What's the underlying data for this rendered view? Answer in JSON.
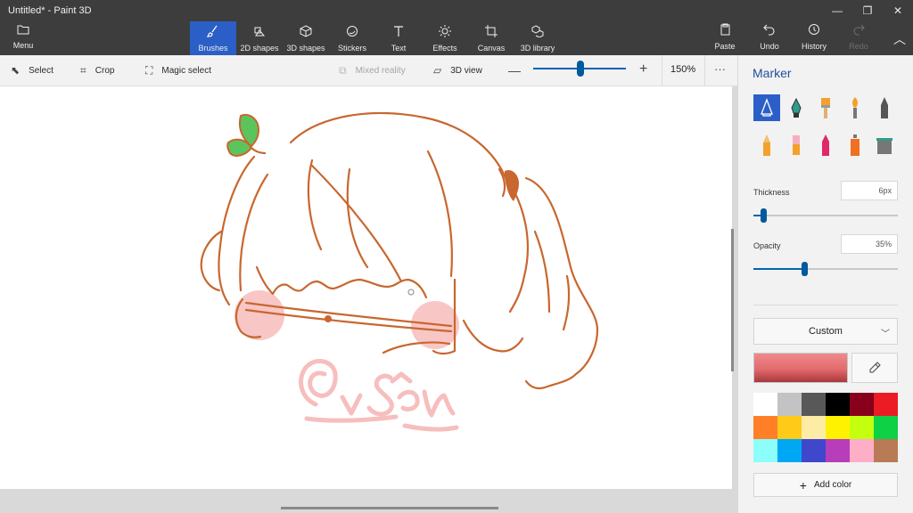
{
  "window": {
    "title": "Untitled* - Paint 3D",
    "minimize": "—",
    "maximize": "❐",
    "close": "✕"
  },
  "ribbon": {
    "menu_label": "Menu",
    "tabs": [
      {
        "label": "Brushes",
        "icon": "brush-icon",
        "active": true
      },
      {
        "label": "2D shapes",
        "icon": "2d-shapes-icon"
      },
      {
        "label": "3D shapes",
        "icon": "3d-shapes-icon"
      },
      {
        "label": "Stickers",
        "icon": "stickers-icon"
      },
      {
        "label": "Text",
        "icon": "text-icon"
      },
      {
        "label": "Effects",
        "icon": "effects-icon"
      },
      {
        "label": "Canvas",
        "icon": "canvas-icon"
      },
      {
        "label": "3D library",
        "icon": "3d-library-icon"
      }
    ],
    "paste_label": "Paste",
    "undo_label": "Undo",
    "history_label": "History",
    "redo_label": "Redo"
  },
  "toolbar": {
    "select_label": "Select",
    "crop_label": "Crop",
    "magic_select_label": "Magic select",
    "mixed_reality_label": "Mixed reality",
    "view3d_label": "3D view",
    "zoom_value": "150%",
    "zoom_level": 0.51,
    "more_label": "···"
  },
  "panel": {
    "title": "Marker",
    "brushes": [
      "marker-icon",
      "calligraphy-pen-icon",
      "oil-brush-icon",
      "watercolor-icon",
      "pixel-pen-icon",
      "pencil-icon",
      "eraser-icon",
      "crayon-icon",
      "spray-can-icon",
      "fill-icon"
    ],
    "thickness_label": "Thickness",
    "thickness_value": "6px",
    "thickness_level": 0.07,
    "opacity_label": "Opacity",
    "opacity_value": "35%",
    "opacity_level": 0.35,
    "color_mode": "Custom",
    "current_color": "#e26a6d",
    "palette": [
      "#ffffff",
      "#c3c3c3",
      "#585858",
      "#000000",
      "#88001b",
      "#ec1c24",
      "#ff7f27",
      "#ffca18",
      "#fdeca6",
      "#fff200",
      "#c4ff0e",
      "#0ed145",
      "#8cfffb",
      "#00a8f3",
      "#3f48cc",
      "#b83dba",
      "#ffaec8",
      "#b97a56"
    ],
    "add_color_label": "Add color"
  },
  "canvas": {
    "stroke_color": "#c8672f",
    "blush_color": "#f7b3b3",
    "sprout_color": "#5cc45c",
    "signature_color": "#f6b3b3"
  }
}
